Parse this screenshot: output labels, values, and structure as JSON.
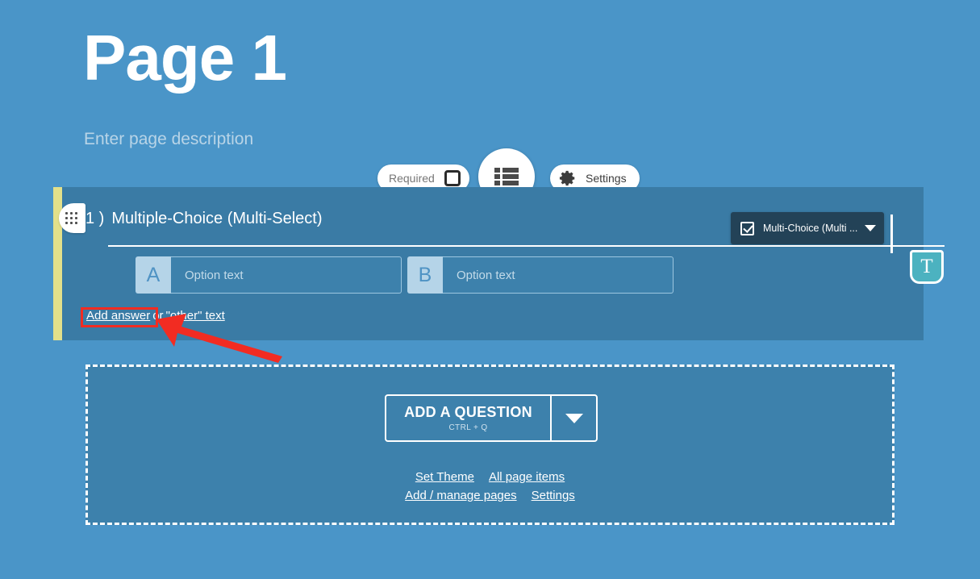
{
  "page": {
    "title": "Page 1",
    "description": "Enter page description",
    "background_color": "#4a95c8"
  },
  "toolbar": {
    "required_label": "Required",
    "required_checked": false,
    "list_icon": "list-icon",
    "gear_icon": "gear-icon",
    "settings_label": "Settings"
  },
  "question": {
    "number": "1 )",
    "title": "Multiple-Choice (Multi-Select)",
    "accent_color": "#e3e08a",
    "panel_color": "#3a7ba5",
    "drag_handle_icon": "drag-dots-icon",
    "type_select": {
      "icon": "checkbox-checked-icon",
      "label": "Multi-Choice (Multi ...",
      "caret": "chevron-down-icon"
    },
    "options": [
      {
        "letter": "A",
        "value": "",
        "placeholder": "Option text"
      },
      {
        "letter": "B",
        "value": "",
        "placeholder": "Option text"
      }
    ],
    "add_answer_label": "Add answer",
    "add_answer_conjunction": "or",
    "other_text_label": "\"other\" text",
    "text_format_button_label": "T",
    "text_format_color": "#4cb2c0"
  },
  "add_area": {
    "button_label": "ADD A QUESTION",
    "button_shortcut": "CTRL + Q",
    "caret": "chevron-down-icon",
    "links": [
      "Set Theme",
      "All page items",
      "Add / manage pages",
      "Settings"
    ]
  },
  "annotation": {
    "highlight_color": "#f22c22",
    "target": "Add answer"
  }
}
